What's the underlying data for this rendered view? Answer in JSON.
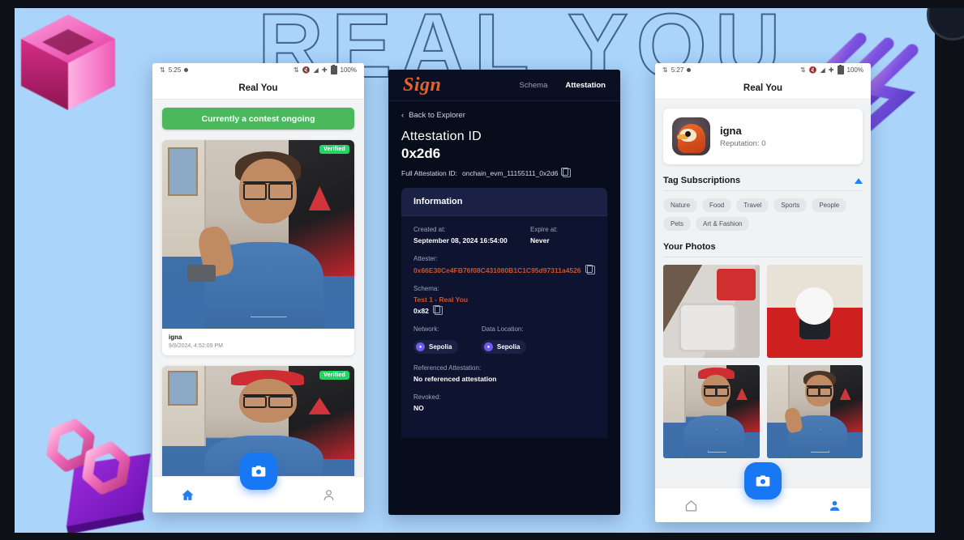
{
  "background": {
    "wordart": "REAL YOU",
    "stage_color": "#aad4fa",
    "frame_color": "#0d1117",
    "decorations": [
      {
        "name": "pink-cube-decoration"
      },
      {
        "name": "purple-zigzag-decoration"
      },
      {
        "name": "pink-infinity-decoration"
      }
    ]
  },
  "phone_left": {
    "statusbar": {
      "time": "5:25",
      "battery": "100%"
    },
    "header_title": "Real You",
    "contest_banner": "Currently a contest ongoing",
    "posts": [
      {
        "badge": "Verified",
        "user": "igna",
        "timestamp": "9/8/2024, 4:52:09 PM"
      },
      {
        "badge": "Verified",
        "user": "",
        "timestamp": ""
      }
    ],
    "nav": {
      "home_label": "home-icon",
      "camera_label": "camera-icon",
      "profile_label": "person-icon",
      "active": "home"
    }
  },
  "phone_mid": {
    "brand": "Sign",
    "nav_links": [
      "Schema",
      "Attestation"
    ],
    "active_link": "Attestation",
    "back_label": "Back to Explorer",
    "attestation_id_label": "Attestation ID",
    "attestation_id": "0x2d6",
    "full_id_label": "Full Attestation ID:",
    "full_id_value": "onchain_evm_11155111_0x2d6",
    "info_title": "Information",
    "fields": {
      "created_at_label": "Created at:",
      "created_at_value": "September 08, 2024 16:54:00",
      "expire_at_label": "Expire at:",
      "expire_at_value": "Never",
      "attester_label": "Attester:",
      "attester_value": "0x66E30Ce4FB76f08C431080B1C1C95d97311a4526",
      "schema_label": "Schema:",
      "schema_name": "Test 1 - Real You",
      "schema_id": "0x82",
      "network_label": "Network:",
      "network_value": "Sepolia",
      "data_location_label": "Data Location:",
      "data_location_value": "Sepolia",
      "referenced_label": "Referenced Attestation:",
      "referenced_value": "No referenced attestation",
      "revoked_label": "Revoked:",
      "revoked_value": "NO"
    },
    "accent_orange": "#c8542a",
    "chain_color": "#6f5bf0"
  },
  "phone_right": {
    "statusbar": {
      "time": "5:27",
      "battery": "100%"
    },
    "header_title": "Real You",
    "profile": {
      "username": "igna",
      "reputation": "Reputation: 0"
    },
    "tag_section_title": "Tag Subscriptions",
    "tags": [
      "Nature",
      "Food",
      "Travel",
      "Sports",
      "People",
      "Pets",
      "Art & Fashion"
    ],
    "photos_section_title": "Your Photos",
    "photos": [
      {
        "name": "photo-fan"
      },
      {
        "name": "photo-plush"
      },
      {
        "name": "photo-selfie-cap"
      },
      {
        "name": "photo-selfie-thumb"
      }
    ],
    "nav": {
      "home_label": "home-icon",
      "camera_label": "camera-icon",
      "profile_label": "person-icon",
      "active": "profile"
    }
  }
}
